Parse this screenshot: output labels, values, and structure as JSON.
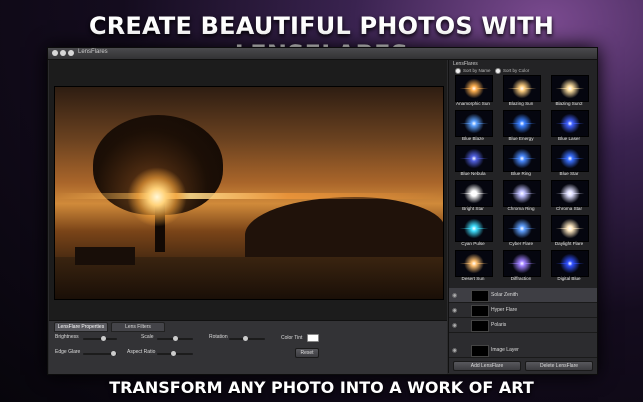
{
  "marketing": {
    "headline": "CREATE BEAUTIFUL PHOTOS WITH LENSFLARES",
    "subline": "TRANSFORM ANY PHOTO INTO A WORK OF ART"
  },
  "window": {
    "title": "LensFlares"
  },
  "tabs": [
    {
      "label": "LensFlare Properties",
      "active": true
    },
    {
      "label": "Lens Filters",
      "active": false
    }
  ],
  "controls": {
    "brightness": "Brightness",
    "scale": "Scale",
    "rotation": "Rotation",
    "color_tint": "Color Tint",
    "edge_glare": "Edge Glare",
    "aspect_ratio": "Aspect Ratio",
    "reset": "Reset"
  },
  "sidebar": {
    "title": "LensFlares",
    "sort_by_name": "Sort by Name",
    "sort_by_color": "Sort by Color",
    "flares": [
      {
        "name": "Anamorphic Sun",
        "color": "#ffb050"
      },
      {
        "name": "Blazing Sun",
        "color": "#ffcf80"
      },
      {
        "name": "Blazing Sun2",
        "color": "#ffe0a0"
      },
      {
        "name": "Blue Blaze",
        "color": "#5aa0ff"
      },
      {
        "name": "Blue Energy",
        "color": "#3a80ff"
      },
      {
        "name": "Blue Laser",
        "color": "#4060ff"
      },
      {
        "name": "Blue Nebula",
        "color": "#5060e0"
      },
      {
        "name": "Blue Ring",
        "color": "#4a8aff"
      },
      {
        "name": "Blue Star",
        "color": "#3a70ff"
      },
      {
        "name": "Bright Star",
        "color": "#ffffff"
      },
      {
        "name": "Chroma Ring",
        "color": "#c0c0ff"
      },
      {
        "name": "Chroma Star",
        "color": "#e0e0ff"
      },
      {
        "name": "Cyan Pulse",
        "color": "#40e0ff"
      },
      {
        "name": "Cyber Flare",
        "color": "#60a0ff"
      },
      {
        "name": "Daylight Flare",
        "color": "#ffe8c0"
      },
      {
        "name": "Desert Sun",
        "color": "#ffc070"
      },
      {
        "name": "Diffraction",
        "color": "#a080ff"
      },
      {
        "name": "Digital Blue",
        "color": "#3050ff"
      }
    ]
  },
  "layers": [
    {
      "name": "Solar Zenith",
      "selected": true
    },
    {
      "name": "Hyper Flare",
      "selected": false
    },
    {
      "name": "Polaris",
      "selected": false
    }
  ],
  "image_layer": "Image Layer",
  "buttons": {
    "add": "Add LensFlare",
    "delete": "Delete LensFlare"
  }
}
